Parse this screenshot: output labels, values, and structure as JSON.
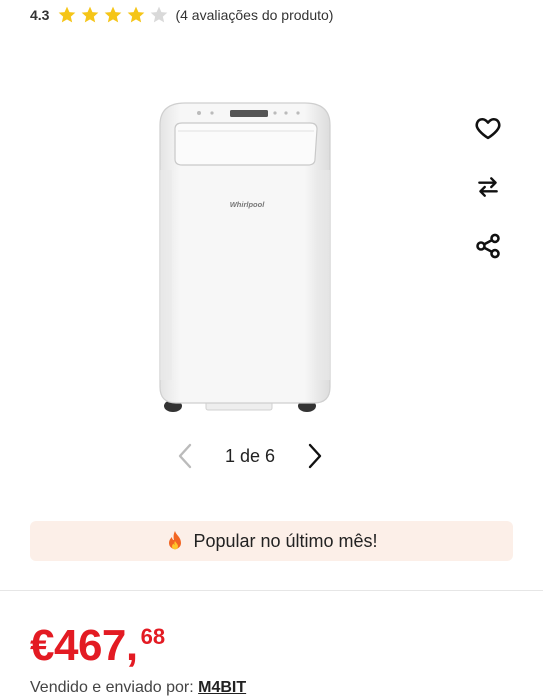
{
  "rating": {
    "value": "4.3",
    "stars_filled": 4,
    "stars_total": 5,
    "reviews_text": "(4 avaliações do produto)",
    "star_color": "#f5c518",
    "star_empty_color": "#d9d9d9"
  },
  "product_image": {
    "brand_text": "Whirlpool",
    "alt": "Whirlpool portable air conditioner"
  },
  "actions": {
    "wishlist_icon": "heart-icon",
    "compare_icon": "compare-arrows-icon",
    "share_icon": "share-icon"
  },
  "gallery": {
    "counter": "1 de 6"
  },
  "banner": {
    "icon": "fire-icon",
    "text": "Popular no último mês!",
    "background": "#fcefe8"
  },
  "price": {
    "main": "€467,",
    "cents": "68",
    "color": "#e31b23"
  },
  "seller": {
    "label": "Vendido e enviado por:",
    "name": "M4BIT"
  }
}
